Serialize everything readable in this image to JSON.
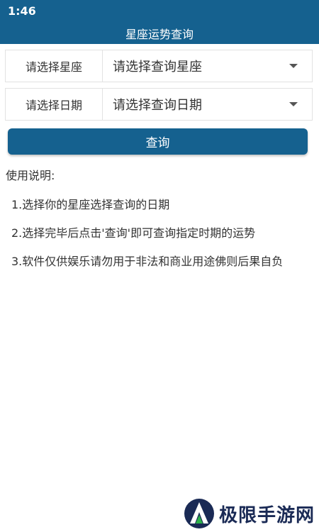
{
  "status_bar": {
    "time": "1:46"
  },
  "header": {
    "title": "星座运势查询"
  },
  "form": {
    "constellation": {
      "label": "请选择星座",
      "value": "请选择查询星座"
    },
    "date": {
      "label": "请选择日期",
      "value": "请选择查询日期"
    },
    "query_button": "查询"
  },
  "instructions": {
    "title": "使用说明:",
    "items": [
      "1.选择你的星座选择查询的日期",
      "2.选择完毕后点击'查询'即可查询指定时期的运势",
      "3.软件仅供娱乐请勿用于非法和商业用途佛则后果自负"
    ]
  },
  "watermark": {
    "text": "极限手游网"
  },
  "colors": {
    "primary": "#15618f",
    "border": "#e2e2e2",
    "text": "#333333"
  }
}
